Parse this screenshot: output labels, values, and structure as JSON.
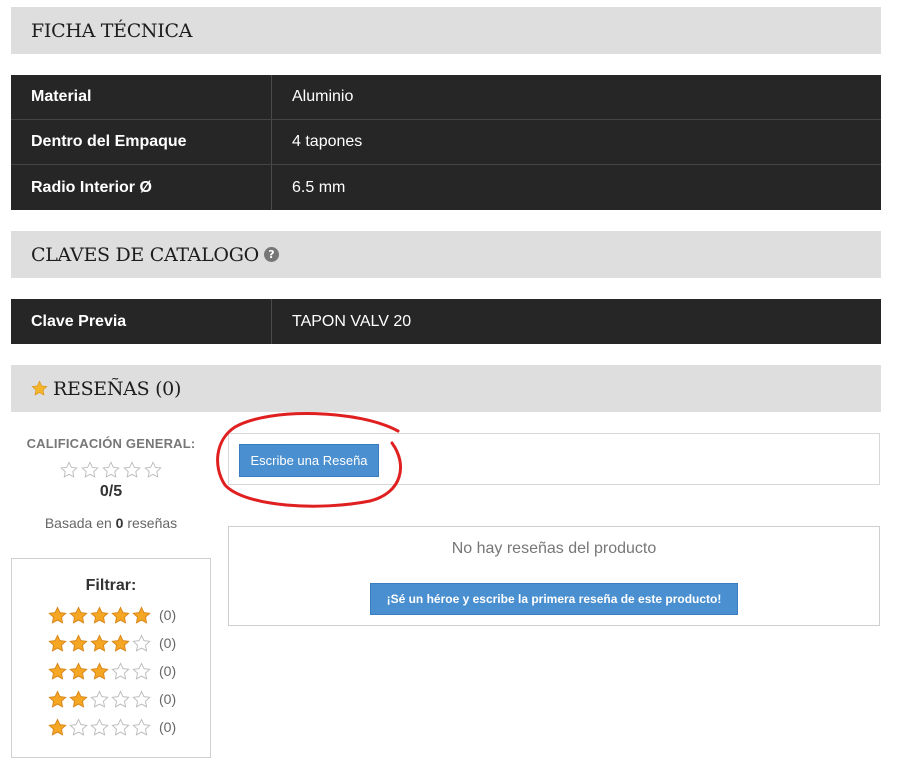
{
  "ficha": {
    "title": "FICHA TÉCNICA",
    "rows": [
      {
        "key": "Material",
        "value": "Aluminio"
      },
      {
        "key": "Dentro del Empaque",
        "value": "4 tapones"
      },
      {
        "key": "Radio Interior Ø",
        "value": "6.5 mm"
      }
    ]
  },
  "claves": {
    "title": "CLAVES DE CATALOGO",
    "help_glyph": "?",
    "rows": [
      {
        "key": "Clave Previa",
        "value": "TAPON VALV 20"
      }
    ]
  },
  "resenas": {
    "title": "RESEÑAS (0)",
    "rating": {
      "title": "CALIFICACIÓN GENERAL:",
      "score": "0/5",
      "stars_filled": 0,
      "stars_total": 5,
      "based_prefix": "Basada en",
      "based_count": "0",
      "based_suffix": "reseñas"
    },
    "filter": {
      "title": "Filtrar:",
      "rows": [
        {
          "stars": 5,
          "count": "(0)"
        },
        {
          "stars": 4,
          "count": "(0)"
        },
        {
          "stars": 3,
          "count": "(0)"
        },
        {
          "stars": 2,
          "count": "(0)"
        },
        {
          "stars": 1,
          "count": "(0)"
        }
      ]
    },
    "write_button": "Escribe una Reseña",
    "no_reviews": "No hay reseñas del producto",
    "hero_button": "¡Sé un héroe y escribe la primera reseña de este producto!"
  },
  "colors": {
    "star_filled": "#f5a623",
    "star_empty": "#bbbbbb",
    "button_blue": "#4a8fd0",
    "annotation_red": "#e02020",
    "table_dark": "#262626",
    "header_gray": "#dedede"
  }
}
